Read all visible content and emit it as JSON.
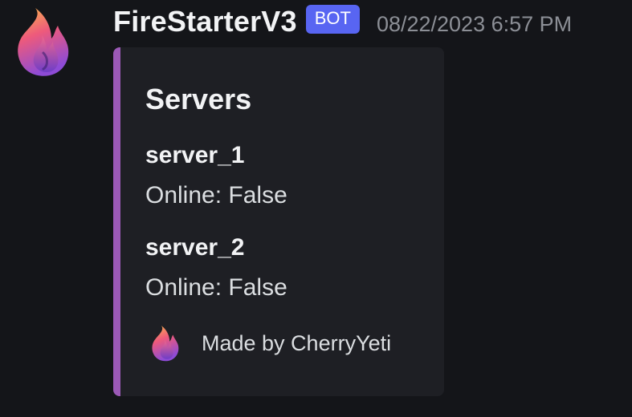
{
  "message": {
    "username": "FireStarterV3",
    "badge": "BOT",
    "timestamp": "08/22/2023 6:57 PM",
    "avatar_icon": "flame-icon"
  },
  "embed": {
    "accent_color": "#9b59b6",
    "title": "Servers",
    "fields": [
      {
        "name": "server_1",
        "value": "Online: False"
      },
      {
        "name": "server_2",
        "value": "Online: False"
      }
    ],
    "footer": {
      "icon": "flame-icon",
      "text": "Made by CherryYeti"
    }
  },
  "colors": {
    "background": "#141519",
    "embed_background": "#1e1f24",
    "badge": "#5865f2"
  }
}
